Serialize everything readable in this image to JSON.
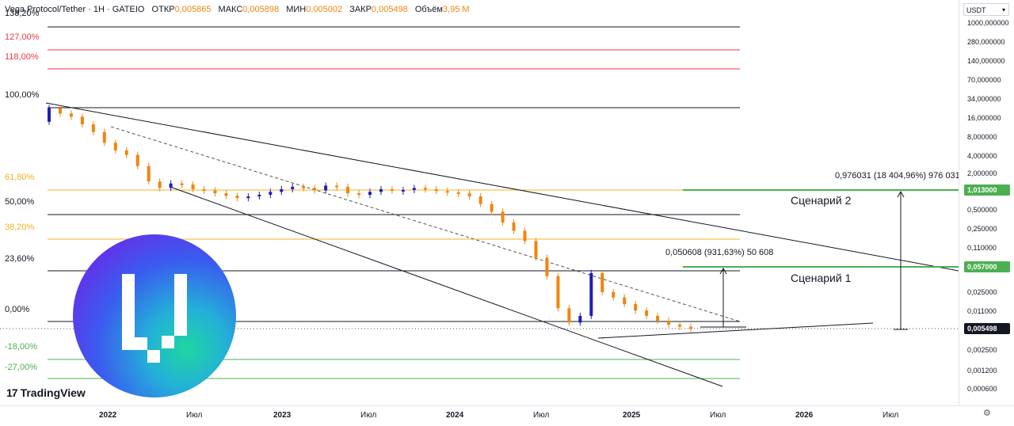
{
  "header": {
    "symbol": "Vega Protocol/Tether · 1H · GATEIO",
    "open_label": "ОТКР",
    "open_value": "0,005865",
    "high_label": "МАКС",
    "high_value": "0,005898",
    "low_label": "МИН",
    "low_value": "0,005002",
    "close_label": "ЗАКР",
    "close_value": "0,005498",
    "volume_label": "Объём",
    "volume_value": "3,95 M"
  },
  "currency_select": "USDT",
  "brand": {
    "logo_text": "TradingView"
  },
  "chart_data": {
    "type": "candlestick",
    "scale": "log",
    "x_axis_labels": [
      "2022",
      "Июл",
      "2023",
      "Июл",
      "2024",
      "Июл",
      "2025",
      "Июл",
      "2026",
      "Июл"
    ],
    "y_axis_labels": [
      "1000,000000",
      "280,000000",
      "140,000000",
      "70,000000",
      "34,000000",
      "16,000000",
      "8,000000",
      "4,000000",
      "2,000000",
      "0,500000",
      "0,250000",
      "0,110000",
      "0,025000",
      "0,011000",
      "0,002500",
      "0,001200",
      "0,000600"
    ],
    "price_marks": [
      {
        "value": "1,013000",
        "color": "#4caf50"
      },
      {
        "value": "0,057000",
        "color": "#4caf50"
      },
      {
        "value": "0,005498",
        "color": "#131722"
      }
    ],
    "fib_levels": [
      {
        "label": "138,20%",
        "color": "#131722",
        "style": "solid"
      },
      {
        "label": "127,00%",
        "color": "#f23645",
        "style": "solid"
      },
      {
        "label": "118,00%",
        "color": "#f23645",
        "style": "solid"
      },
      {
        "label": "100,00%",
        "color": "#131722",
        "style": "solid"
      },
      {
        "label": "61,80%",
        "color": "#f0b323",
        "style": "solid"
      },
      {
        "label": "50,00%",
        "color": "#131722",
        "style": "solid"
      },
      {
        "label": "38,20%",
        "color": "#f0b323",
        "style": "solid"
      },
      {
        "label": "23,60%",
        "color": "#131722",
        "style": "solid"
      },
      {
        "label": "0,00%",
        "color": "#131722",
        "style": "solid"
      },
      {
        "label": "-18,00%",
        "color": "#4caf50",
        "style": "solid"
      },
      {
        "label": "-27,00%",
        "color": "#4caf50",
        "style": "solid"
      }
    ],
    "annotations": [
      {
        "text": "0,976031 (18 404,96%) 976 031"
      },
      {
        "text": "Сценарий 2"
      },
      {
        "text": "0,050608 (931,63%) 50 608"
      },
      {
        "text": "Сценарий 1"
      }
    ],
    "series": [
      {
        "name": "price",
        "values": [
          22.0,
          18.0,
          16.0,
          12.0,
          9.0,
          6.0,
          4.5,
          3.8,
          2.5,
          1.4,
          1.1,
          1.3,
          1.25,
          1.05,
          1.0,
          0.9,
          0.82,
          0.75,
          0.8,
          0.85,
          0.95,
          1.05,
          1.15,
          1.1,
          1.0,
          1.2,
          1.15,
          0.9,
          0.85,
          0.95,
          1.05,
          1.0,
          1.02,
          1.1,
          1.05,
          0.98,
          0.93,
          0.9,
          0.8,
          0.6,
          0.45,
          0.3,
          0.22,
          0.15,
          0.08,
          0.04,
          0.012,
          0.007,
          0.009,
          0.045,
          0.022,
          0.018,
          0.014,
          0.011,
          0.009,
          0.0075,
          0.0065,
          0.006,
          0.0055
        ]
      }
    ]
  }
}
